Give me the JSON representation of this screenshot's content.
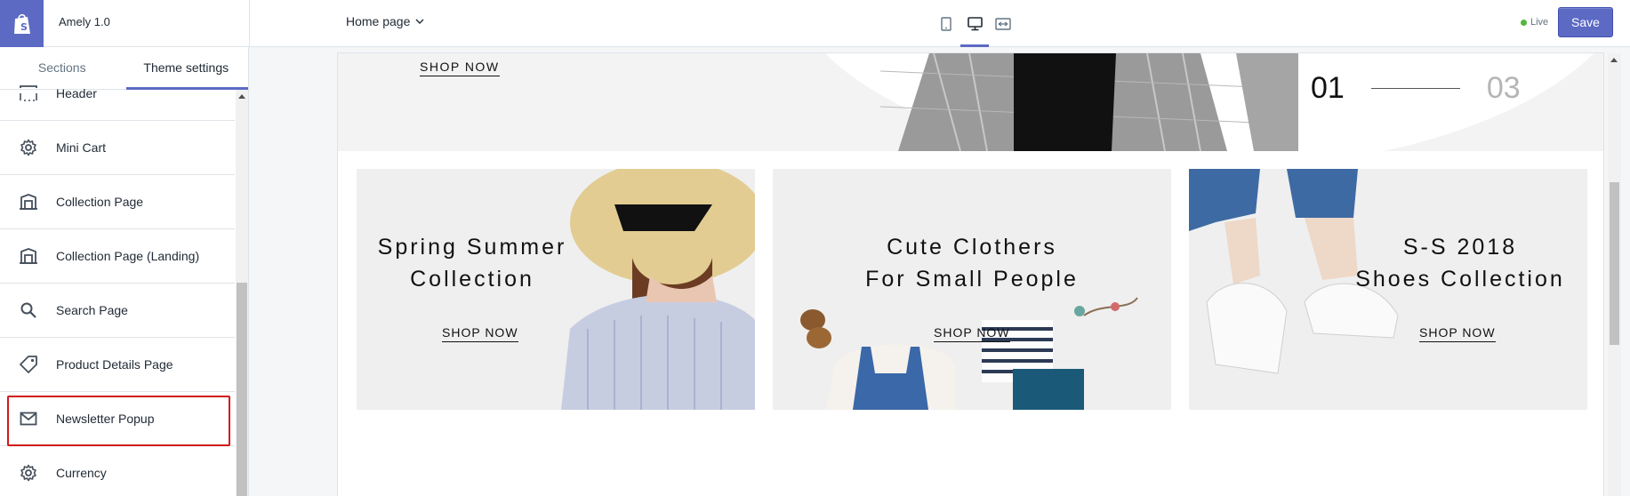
{
  "app": {
    "title": "Amely 1.0",
    "brand_color": "#5c6ac4"
  },
  "topbar": {
    "page_select": "Home page",
    "devices": [
      "mobile-icon",
      "desktop-icon",
      "fullscreen-icon"
    ],
    "live_label": "Live",
    "save_label": "Save"
  },
  "sidebar": {
    "tabs": [
      {
        "label": "Sections"
      },
      {
        "label": "Theme settings"
      }
    ],
    "items": [
      {
        "label": "Header",
        "icon": "header-icon"
      },
      {
        "label": "Mini Cart",
        "icon": "gear-icon"
      },
      {
        "label": "Collection Page",
        "icon": "collection-icon"
      },
      {
        "label": "Collection Page (Landing)",
        "icon": "collection-icon"
      },
      {
        "label": "Search Page",
        "icon": "search-icon"
      },
      {
        "label": "Product Details Page",
        "icon": "tag-icon"
      },
      {
        "label": "Newsletter Popup",
        "icon": "mail-icon"
      },
      {
        "label": "Currency",
        "icon": "gear-icon"
      }
    ],
    "selected_color": "#d21919"
  },
  "preview": {
    "hero": {
      "shop_now": "SHOP NOW",
      "slide_current": "01",
      "slide_total": "03"
    },
    "banners": [
      {
        "title_line1": "Spring Summer",
        "title_line2": "Collection",
        "shop_now": "SHOP NOW"
      },
      {
        "title_line1": "Cute Clothers",
        "title_line2": "For Small People",
        "shop_now": "SHOP NOW"
      },
      {
        "title_line1": "S-S 2018",
        "title_line2": "Shoes Collection",
        "shop_now": "SHOP NOW"
      }
    ]
  }
}
